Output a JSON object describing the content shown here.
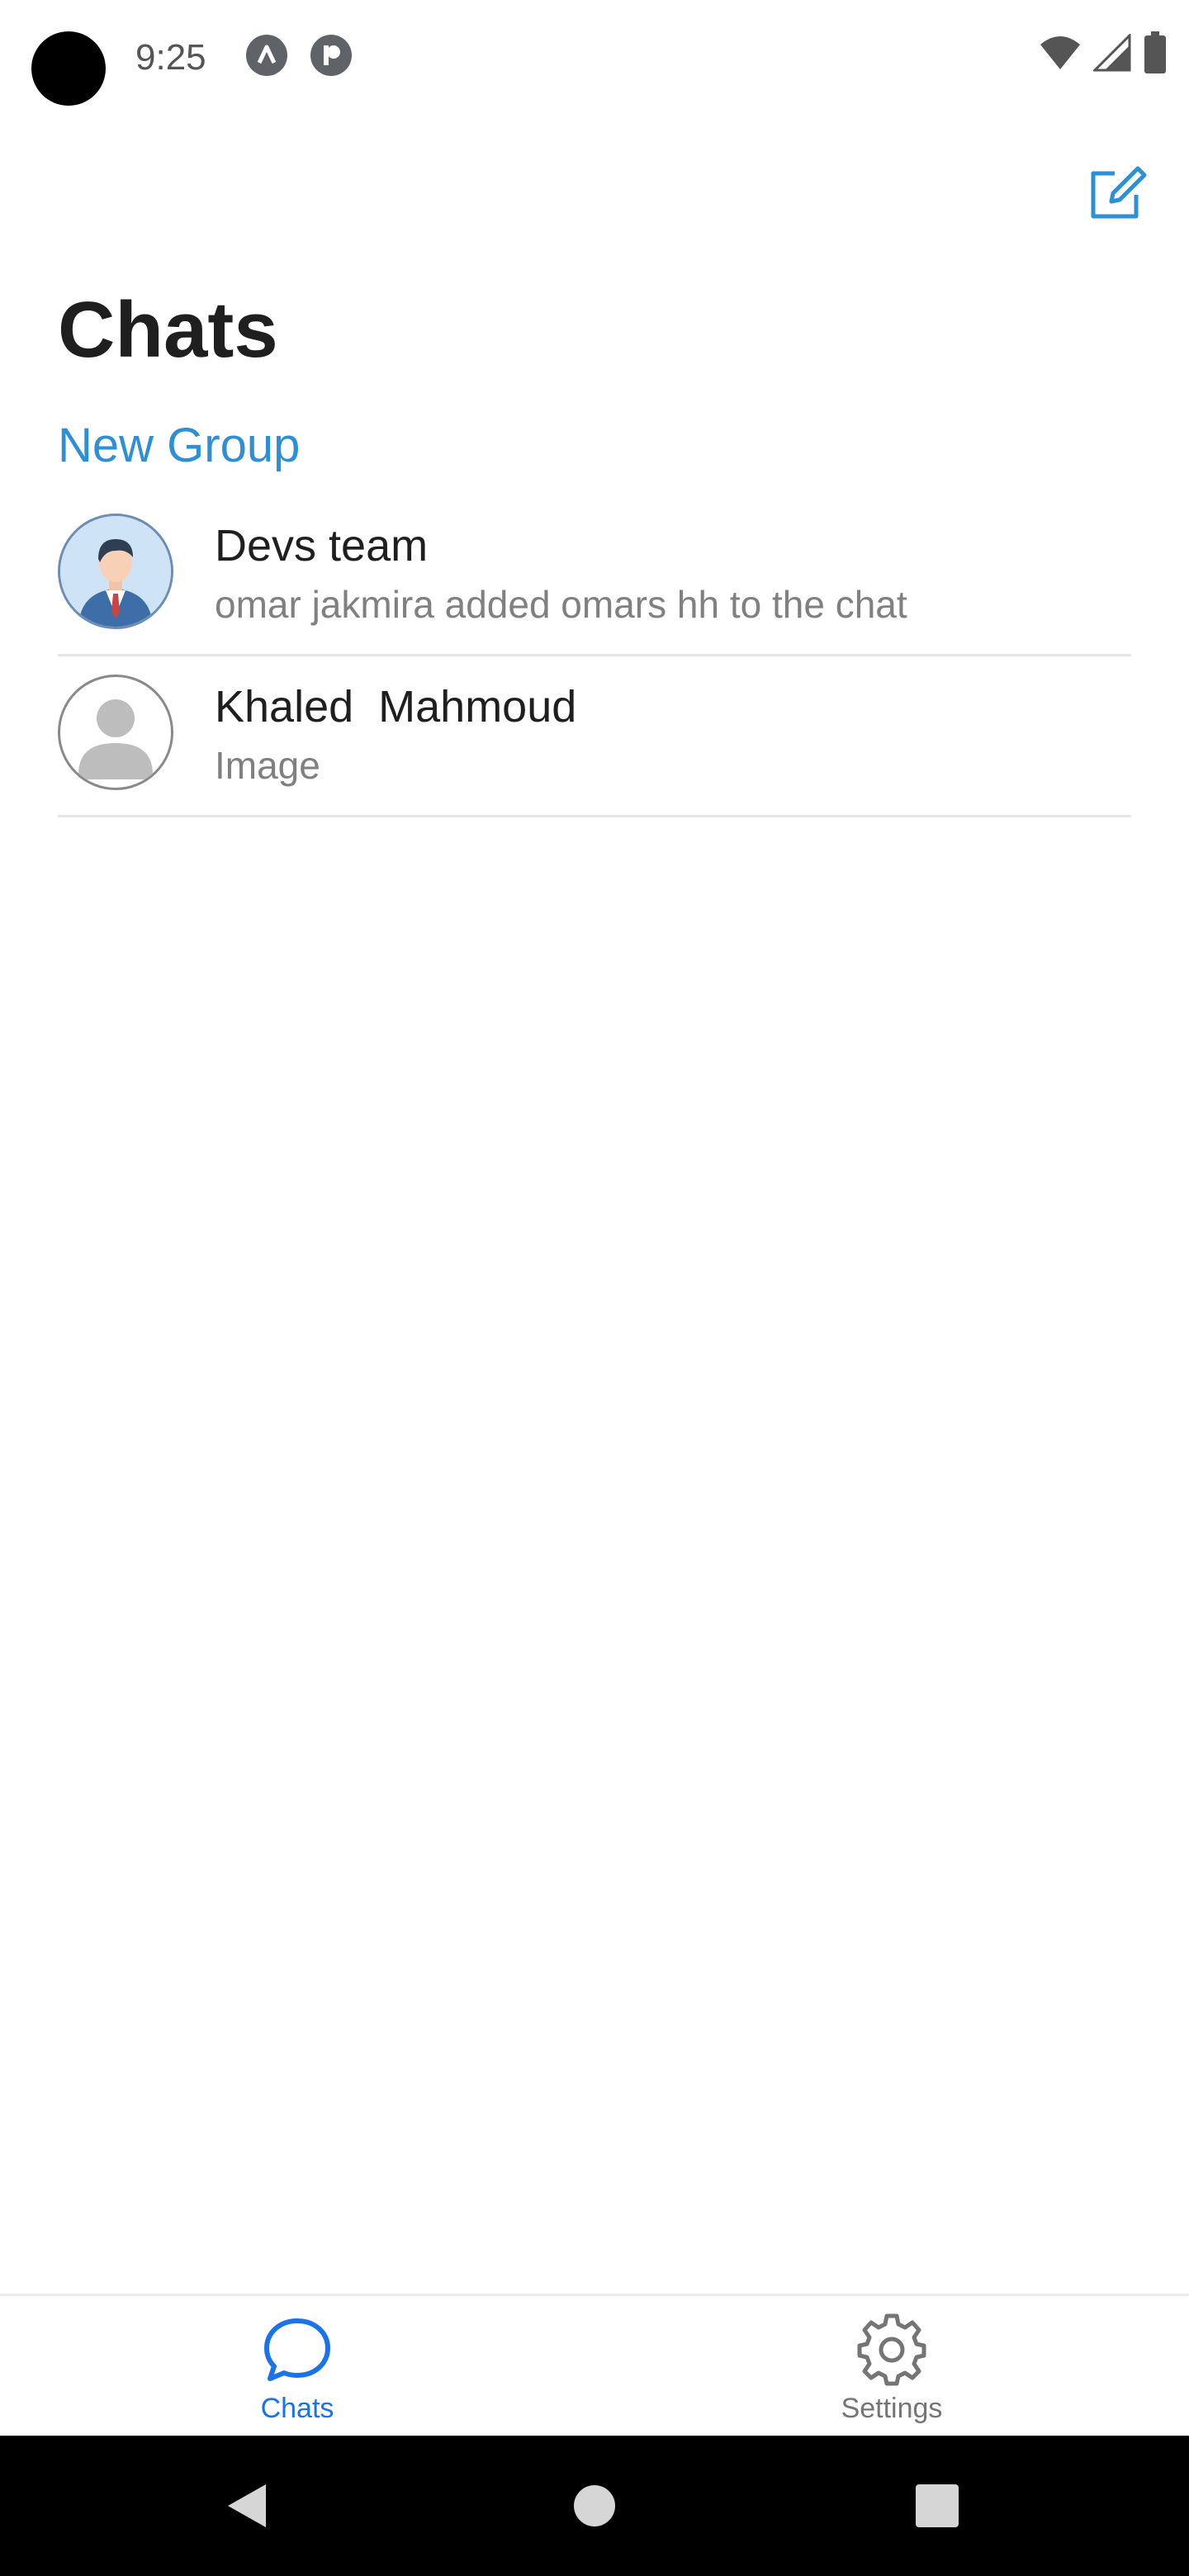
{
  "status_bar": {
    "time": "9:25"
  },
  "header": {
    "title": "Chats",
    "new_group_label": "New Group",
    "compose_icon": "compose-icon"
  },
  "chats": [
    {
      "name": "Devs team",
      "preview": "omar jakmira added omars hh to the chat",
      "avatar": "businessman-avatar"
    },
    {
      "name": "Khaled  Mahmoud",
      "preview": "Image",
      "avatar": "placeholder-avatar"
    }
  ],
  "tabs": [
    {
      "label": "Chats",
      "icon": "chat-bubble-icon",
      "active": true
    },
    {
      "label": "Settings",
      "icon": "gear-icon",
      "active": false
    }
  ],
  "colors": {
    "accent": "#2d8fd5",
    "tab_active": "#1a73e8",
    "tab_inactive": "#757575",
    "title": "#1f1f1f",
    "preview": "#808080",
    "divider": "#e6e6e6"
  }
}
